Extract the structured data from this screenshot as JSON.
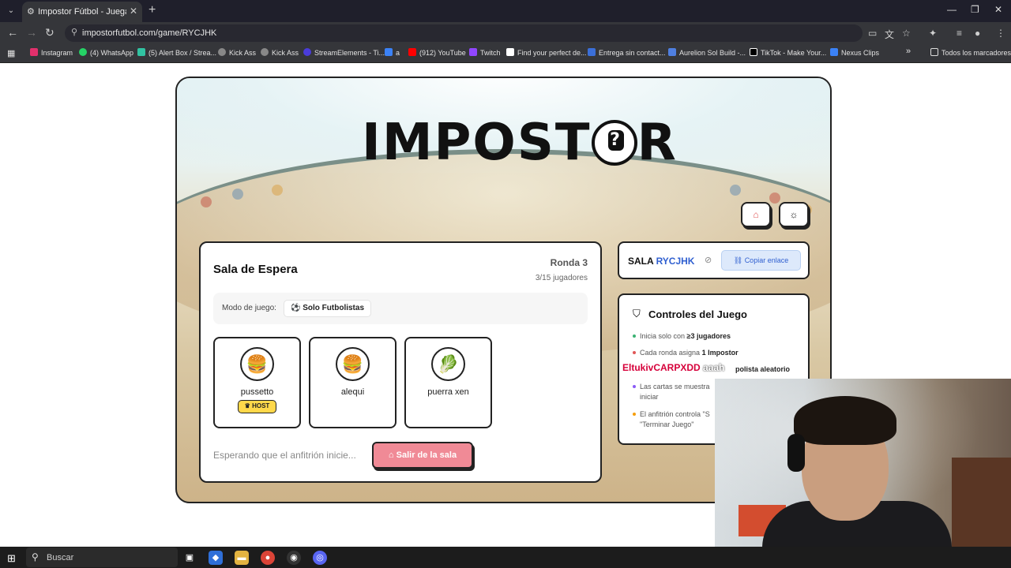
{
  "browser": {
    "tab_title": "Impostor Fútbol - Juega con ami",
    "url": "impostorfutbol.com/game/RYCJHK",
    "bookmarks": [
      {
        "label": "Instagram",
        "color": "#e1306c"
      },
      {
        "label": "(4) WhatsApp",
        "color": "#25d366"
      },
      {
        "label": "(5) Alert Box / Strea...",
        "color": "#31c3a2"
      },
      {
        "label": "Kick Ass",
        "color": "#888888"
      },
      {
        "label": "Kick Ass",
        "color": "#888888"
      },
      {
        "label": "StreamElements - Ti...",
        "color": "#4a3cdb"
      },
      {
        "label": "a",
        "color": "#3b82f6"
      },
      {
        "label": "(912) YouTube",
        "color": "#ff0000"
      },
      {
        "label": "Twitch",
        "color": "#9146ff"
      },
      {
        "label": "Find your perfect de...",
        "color": "#ffffff"
      },
      {
        "label": "Entrega sin contact...",
        "color": "#3b6fd8"
      },
      {
        "label": "Aurelion Sol Build -...",
        "color": "#4f7fe0"
      },
      {
        "label": "TikTok - Make Your...",
        "color": "#000000"
      },
      {
        "label": "Nexus Clips",
        "color": "#3b82f6"
      }
    ],
    "all_bookmarks": "Todos los marcadores"
  },
  "game": {
    "logo_text_left": "IMPOST",
    "logo_ball_mark": "?",
    "logo_text_right": "R",
    "room": {
      "title": "Sala de Espera",
      "round": "Ronda 3",
      "players_count": "3/15 jugadores",
      "mode_label": "Modo de juego:",
      "mode_value": "Solo Futbolistas",
      "players": [
        {
          "name": "pussetto",
          "avatar": "🍔",
          "host": true
        },
        {
          "name": "alequi",
          "avatar": "🍔",
          "host": false
        },
        {
          "name": "puerra xen",
          "avatar": "🥬",
          "host": false
        }
      ],
      "host_badge": "HOST",
      "waiting_text": "Esperando que el anfitrión inicie...",
      "leave_button": "Salir de la sala"
    },
    "sala": {
      "label": "SALA",
      "code": "RYCJHK",
      "copy_button": "Copiar enlace"
    },
    "controls": {
      "title": "Controles del Juego",
      "items": [
        {
          "text": "Inicia solo con ",
          "bold": "≥3 jugadores",
          "color": "#3bb273"
        },
        {
          "text": "Cada ronda asigna ",
          "bold": "1 Impostor",
          "color": "#e05757"
        },
        {
          "text": "",
          "bold": "polista aleatorio",
          "color": "#3b82f6"
        },
        {
          "text": "Las cartas se muestra",
          "bold": "",
          "color": "#8b5cf6"
        },
        {
          "text": "iniciar",
          "bold": "",
          "color": ""
        },
        {
          "text": "El anfitrión controla \"S",
          "bold": "",
          "color": "#f59e0b"
        },
        {
          "text": "\"Terminar Juego\"",
          "bold": "",
          "color": ""
        }
      ]
    }
  },
  "overlay": {
    "username": "EltukivCARPXDD",
    "username_tail": "aaah"
  },
  "taskbar": {
    "search_placeholder": "Buscar"
  }
}
